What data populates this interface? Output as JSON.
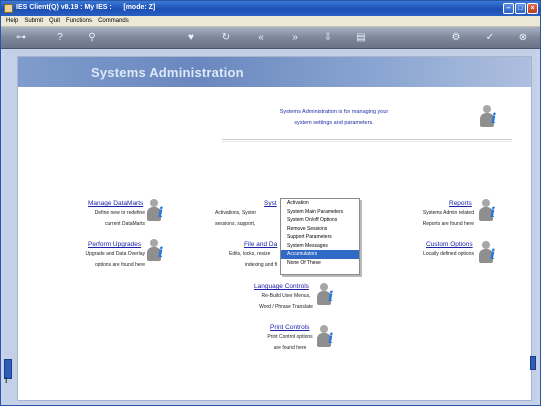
{
  "window": {
    "title": "IES Client(Q) v8.19 : My IES :",
    "mode": "[mode: Z]"
  },
  "menubar": {
    "items": [
      "Help",
      "Submit",
      "Quit",
      "Functions",
      "Commands"
    ]
  },
  "toolbar": {
    "icons": [
      "key-icon",
      "help-icon",
      "search-icon",
      "heart-icon",
      "refresh-icon",
      "rewind-icon",
      "fast-forward-icon",
      "save-icon",
      "notes-icon",
      "settings-icon",
      "check-icon",
      "close-icon"
    ]
  },
  "page": {
    "banner_title": "Systems Administration",
    "intro_line1": "Systems Administration is for managing your",
    "intro_line2": "system settings and parameters."
  },
  "sections": {
    "manage_datamarts": {
      "link": "Manage DataMarts",
      "line1": "Define new or redefine",
      "line2": "current DataMarts"
    },
    "perform_upgrades": {
      "link": "Perform Upgrades",
      "line1": "Upgrade and Data Overlay",
      "line2": "options are found here"
    },
    "system": {
      "link": "Syst",
      "line1": "Activations, Syster",
      "line2": "sessions, support,"
    },
    "file_and_data": {
      "link": "File and Da",
      "line1": "Edits, locks, resize",
      "line2": "indexing and fi"
    },
    "reports": {
      "link": "Reports",
      "line1": "Systems Admin related",
      "line2": "Reports are found here"
    },
    "custom_options": {
      "link": "Custom Options",
      "line1": "Locally defined options"
    },
    "language_controls": {
      "link": "Language Controls",
      "line1": "Re-Build User Menus,",
      "line2": "Word / Phrase Translate"
    },
    "print_controls": {
      "link": "Print Controls",
      "line1": "Print Control options",
      "line2": "are found here"
    }
  },
  "popup_menu": {
    "options": [
      "Activation",
      "System Main Parameters",
      "System On/off Options",
      "Remove Sessions",
      "Support Parameters",
      "System Messages",
      "Accumulators",
      "None Of These"
    ],
    "selected": "Accumulators"
  }
}
